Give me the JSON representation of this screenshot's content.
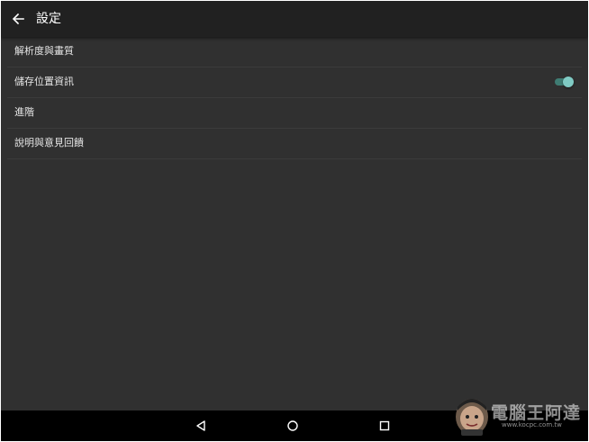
{
  "appbar": {
    "title": "設定",
    "back_icon": "arrow-back-icon"
  },
  "settings": {
    "items": [
      {
        "label": "解析度與畫質"
      },
      {
        "label": "儲存位置資訊",
        "toggle_on": true
      },
      {
        "label": "進階"
      },
      {
        "label": "說明與意見回饋"
      }
    ]
  },
  "navbar": {
    "icons": [
      "back-triangle-icon",
      "home-circle-icon",
      "recents-square-icon"
    ]
  },
  "watermark": {
    "text": "電腦王阿達",
    "url": "www.kocpc.com.tw"
  },
  "colors": {
    "background": "#303030",
    "appbar": "#212121",
    "accent": "#80cbc4",
    "navbar": "#000000"
  }
}
